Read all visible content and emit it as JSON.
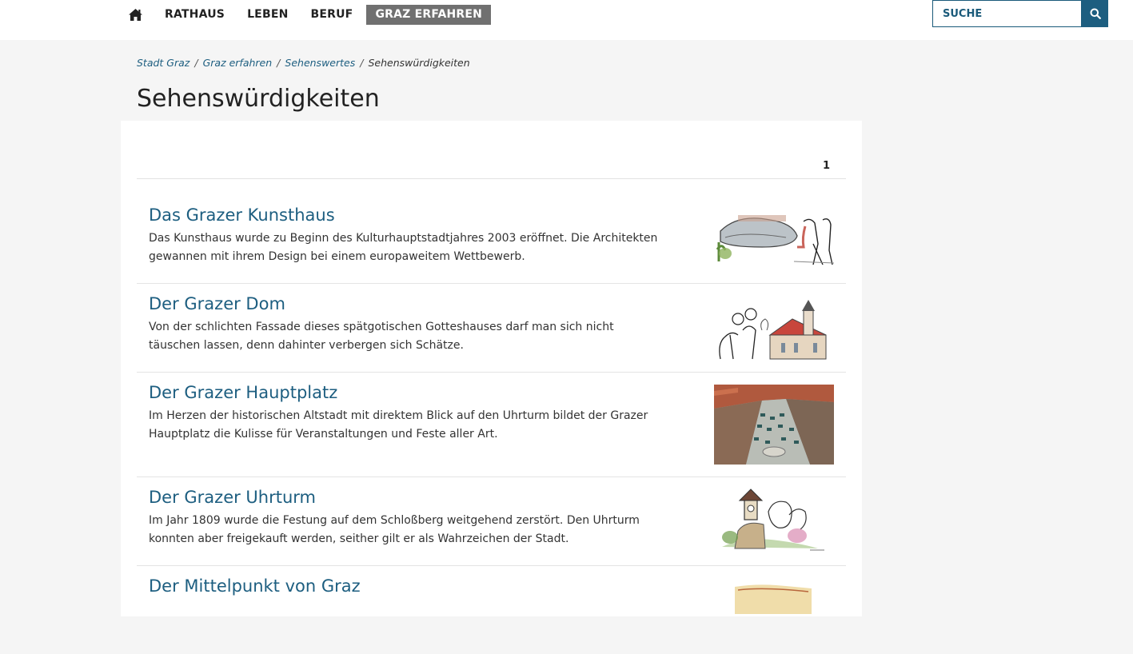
{
  "nav": {
    "items": [
      {
        "label": "RATHAUS"
      },
      {
        "label": "LEBEN"
      },
      {
        "label": "BERUF"
      },
      {
        "label": "GRAZ ERFAHREN",
        "active": true
      }
    ]
  },
  "search": {
    "placeholder": "SUCHE"
  },
  "breadcrumb": {
    "items": [
      "Stadt Graz",
      "Graz erfahren",
      "Sehenswertes"
    ],
    "separator": "/",
    "current": "Sehenswürdigkeiten"
  },
  "page": {
    "title": "Sehenswürdigkeiten"
  },
  "pager": {
    "current": "1"
  },
  "items": [
    {
      "title": "Das Grazer Kunsthaus",
      "text": "Das Kunsthaus wurde zu Beginn des Kulturhauptstadtjahres 2003 eröffnet. Die Architekten gewannen mit ihrem Design bei einem europaweitem Wettbewerb."
    },
    {
      "title": "Der Grazer Dom",
      "text": "Von der schlichten Fassade dieses spätgotischen Gotteshauses darf man sich nicht täuschen lassen, denn dahinter verbergen sich Schätze."
    },
    {
      "title": "Der Grazer Hauptplatz",
      "text": "Im Herzen der historischen Altstadt mit direktem Blick auf den Uhrturm bildet der Grazer Hauptplatz die Kulisse für Veranstaltungen und Feste aller Art."
    },
    {
      "title": "Der Grazer Uhrturm",
      "text": "Im Jahr 1809 wurde die Festung auf dem Schloßberg weitgehend zerstört. Den Uhrturm konnten aber freigekauft werden, seither gilt er als Wahrzeichen der Stadt."
    },
    {
      "title": "Der Mittelpunkt von Graz",
      "text": ""
    }
  ],
  "colors": {
    "accent": "#1d5e80",
    "active_nav": "#707070"
  },
  "icons": {
    "home": "home-icon",
    "search": "search-icon"
  }
}
